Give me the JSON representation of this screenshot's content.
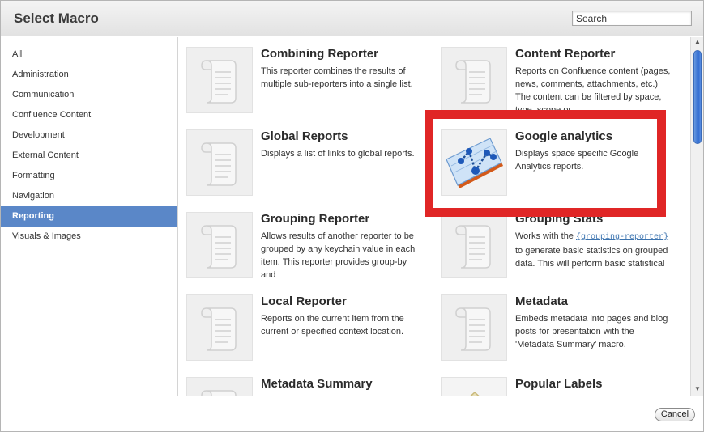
{
  "dialog": {
    "title": "Select Macro"
  },
  "search": {
    "placeholder": "Search",
    "value": ""
  },
  "sidebar": {
    "items": [
      {
        "label": "All"
      },
      {
        "label": "Administration"
      },
      {
        "label": "Communication"
      },
      {
        "label": "Confluence Content"
      },
      {
        "label": "Development"
      },
      {
        "label": "External Content"
      },
      {
        "label": "Formatting"
      },
      {
        "label": "Navigation"
      },
      {
        "label": "Reporting",
        "selected": true
      },
      {
        "label": "Visuals & Images"
      }
    ]
  },
  "macros": [
    {
      "title": "Combining Reporter",
      "description": "This reporter combines the results of multiple sub-reporters into a single list.",
      "icon": "scroll-icon"
    },
    {
      "title": "Content Reporter",
      "description": "Reports on Confluence content (pages, news, comments, attachments, etc.) The content can be filtered by space, type, scope or",
      "icon": "scroll-icon"
    },
    {
      "title": "Global Reports",
      "description": "Displays a list of links to global reports.",
      "icon": "scroll-icon"
    },
    {
      "title": "Google analytics",
      "description": "Displays space specific Google Analytics reports.",
      "icon": "google-analytics-chart-icon"
    },
    {
      "title": "Grouping Reporter",
      "description": "Allows results of another reporter to be grouped by any keychain value in each item. This reporter provides group-by and",
      "icon": "scroll-icon"
    },
    {
      "title": "Grouping Stats",
      "description_before": "Works with the ",
      "description_code": "{grouping-reporter}",
      "description_after": " to generate basic statistics on grouped data. This will perform basic statistical",
      "icon": "scroll-icon"
    },
    {
      "title": "Local Reporter",
      "description": "Reports on the current item from the current or specified context location.",
      "icon": "scroll-icon"
    },
    {
      "title": "Metadata",
      "description": "Embeds metadata into pages and blog posts for presentation with the 'Metadata Summary' macro.",
      "icon": "scroll-icon"
    },
    {
      "title": "Metadata Summary",
      "description": "",
      "icon": "scroll-icon"
    },
    {
      "title": "Popular Labels",
      "description": "",
      "icon": "popular-labels-icon"
    }
  ],
  "footer": {
    "cancel_label": "Cancel"
  },
  "colors": {
    "selected_bg": "#5a87c8",
    "highlight": "#e02626",
    "scrollbar_thumb": "#2f6ad0"
  }
}
